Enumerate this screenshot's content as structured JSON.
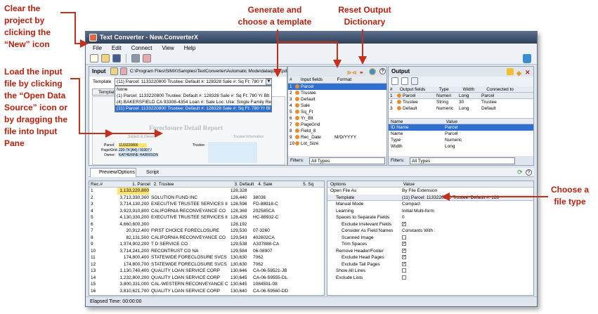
{
  "annotations": {
    "clear_project": "Clear the project by clicking the “New” icon",
    "load_input": "Load the input file by clicking the “Open Data Source” icon or by dragging the file into Input Pane",
    "generate_template": "Generate and choose a template",
    "reset_output": "Reset Output Dictionary",
    "choose_file_type": "Choose a file type"
  },
  "window": {
    "title": "Text Converter - New.ConverterX"
  },
  "menu": [
    "File",
    "Edit",
    "Connect",
    "View",
    "Help"
  ],
  "input": {
    "title": "Input",
    "path": "C:\\Program Files\\SIMX\\Samples\\TextConverter\\Automatic Mode\\dataquick.pdf",
    "template_label": "Template",
    "template_value": "(11) Parcel:  1133220800  Trustee:  Default #:  128328  Sale #:  Sq Ft: 780  Y",
    "dropdown": [
      "None",
      "(1) Parcel:  1133220800  Trustee:  Default #:  128328  Sale #:  Sq Ft: 780  Yr Blt",
      "(4) BAKERSFIELD CA  93308-4354  Loan #:  Sale Loc:  Use: Single Family Residen",
      "(11) Parcel:  1133220800  Trustee:  Default #:  128328  Sale #:  Sq Ft: 780  Yr Bl"
    ],
    "template_tab": "Templat",
    "doc_title": "Foreclosure Detail Report",
    "doc_sub1": "Subject & Owner",
    "doc_sub2": "Trustee Information",
    "doc_lines": [
      "Parcel:",
      "Page/Grid:",
      "Owner:"
    ],
    "doc_values": [
      "1133220800",
      "220-74 [A4] / 93307 /",
      "KATHERINE HARRISON"
    ],
    "doc_trustee": "Trustee:"
  },
  "input_fields": {
    "headers": [
      "#",
      "Input fields",
      "Format"
    ],
    "rows": [
      [
        "1",
        "Parcel",
        ""
      ],
      [
        "2",
        "Trustee",
        ""
      ],
      [
        "3",
        "Default",
        ""
      ],
      [
        "4",
        "Sale",
        ""
      ],
      [
        "5",
        "Sq_Ft",
        ""
      ],
      [
        "6",
        "Yr_Blt",
        ""
      ],
      [
        "7",
        "PageGrid",
        ""
      ],
      [
        "8",
        "Field_8",
        ""
      ],
      [
        "9",
        "Rec_Date",
        "M/D/YYYY"
      ],
      [
        "10",
        "Lot_Size",
        ""
      ]
    ],
    "filter_label": "Filters:",
    "filter_value": "All Types"
  },
  "output": {
    "title": "Output",
    "headers": [
      "#",
      "Output fields",
      "Type",
      "Width",
      "Connected to"
    ],
    "rows": [
      [
        "1",
        "Parcel",
        "Numeri",
        "Long",
        "Parcel"
      ],
      [
        "2",
        "Trustee",
        "String",
        "30",
        "Trustee"
      ],
      [
        "3",
        "Default",
        "Numeric",
        "Long",
        "Default"
      ]
    ],
    "props_headers": [
      "Name",
      "Value"
    ],
    "props": [
      [
        "ID Name",
        "Parcel"
      ],
      [
        "Name",
        "Parcel"
      ],
      [
        "Type",
        "Numeric"
      ],
      [
        "Width",
        "Long"
      ]
    ],
    "filter_label": "Filters:",
    "filter_value": "All Types"
  },
  "tabs": [
    "Preview/Options",
    "Script"
  ],
  "preview": {
    "headers": [
      "Rec.#",
      "1. Parcel",
      "2. Trustee",
      "3. Default",
      "4. Sale",
      "5. Sq"
    ],
    "rows": [
      [
        "1",
        "1,133,220,800",
        "",
        "128,328",
        "",
        ""
      ],
      [
        "2",
        "3,713,330,300",
        "SOLUTION FUND INC",
        "128,440",
        "38036",
        ""
      ],
      [
        "3",
        "3,714,130,200",
        "EXECUTIVE TRUSTEE SERVICES II",
        "128,598",
        "FD-88918-C",
        ""
      ],
      [
        "4",
        "3,923,910,800",
        "CALIFORNIA RECONVEYANCE CO",
        "128,369",
        "202585CA",
        ""
      ],
      [
        "5",
        "4,130,330,200",
        "EXECUTIVE TRUSTEE SERVICES II",
        "128,429",
        "HC-88932-C",
        ""
      ],
      [
        "6",
        "4,660,600,300",
        "",
        "128,192",
        "",
        ""
      ],
      [
        "7",
        "20,912,400",
        "FIRST CHOICE FORECLOSURE",
        "129,530",
        "07-3260",
        ""
      ],
      [
        "8",
        "82,131,500",
        "CALIFORNIA RECONVEYANCE CO",
        "129,543",
        "402602CA",
        ""
      ],
      [
        "9",
        "1,374,902,200",
        "T D SERVICE CO",
        "129,538",
        "A337888-CA",
        ""
      ],
      [
        "10",
        "3,714,241,200",
        "RECONTRUST CO NA",
        "129,584",
        "06-08907",
        ""
      ],
      [
        "11",
        "174,800,400",
        "STATEWIDE FORECLOSURE SVCS",
        "130,630",
        "7062",
        ""
      ],
      [
        "12",
        "174,800,700",
        "STATEWIDE FORECLOSURE SVCS",
        "130,630",
        "7062",
        ""
      ],
      [
        "13",
        "1,130,740,400",
        "QUALITY LOAN SERVICE CORP",
        "130,646",
        "CA-06-59521-JB",
        ""
      ],
      [
        "14",
        "1,232,800,200",
        "QUALITY LOAN SERVICE CORP",
        "130,645",
        "CA-06-59555-DL",
        ""
      ],
      [
        "15",
        "3,800,331,000",
        "CAL-WESTERN RECONVEYANCE C",
        "130,645",
        "1084591-08",
        ""
      ],
      [
        "16",
        "3,810,621,700",
        "QUALITY LOAN SERVICE CORP",
        "130,640",
        "CA-06-59560-DD",
        ""
      ]
    ]
  },
  "options": {
    "headers": [
      "Options",
      "Value"
    ],
    "rows": [
      {
        "name": "Open File As",
        "value": "By File Extension",
        "indent": 0,
        "type": "text"
      },
      {
        "name": "Template",
        "value": "(11) Parcel:  1133220800  Trustee:  Default #:  128",
        "indent": 1,
        "type": "text"
      },
      {
        "name": "Manual Mode",
        "value": "Compact",
        "indent": 1,
        "type": "text"
      },
      {
        "name": "Learning",
        "value": "Initial Multi-form",
        "indent": 1,
        "type": "text"
      },
      {
        "name": "Spaces to Separate Fields",
        "value": "0",
        "indent": 1,
        "type": "text"
      },
      {
        "name": "Exclude Irrelevant Fields",
        "value": "✓",
        "indent": 2,
        "type": "check"
      },
      {
        "name": "Consider As Field Names",
        "value": "Constants With :",
        "indent": 2,
        "type": "text"
      },
      {
        "name": "Scanned Image",
        "value": "",
        "indent": 2,
        "type": "check"
      },
      {
        "name": "Trim Spaces",
        "value": "✓",
        "indent": 2,
        "type": "check"
      },
      {
        "name": "Remove Header/Footer",
        "value": "✓",
        "indent": 1,
        "type": "check"
      },
      {
        "name": "Exclude Head Pages",
        "value": "✓",
        "indent": 2,
        "type": "check"
      },
      {
        "name": "Exclude Tail Pages",
        "value": "✓",
        "indent": 2,
        "type": "check"
      },
      {
        "name": "Show All Lines",
        "value": "",
        "indent": 1,
        "type": "check"
      },
      {
        "name": "Exclude Lists",
        "value": "",
        "indent": 1,
        "type": "check"
      }
    ]
  },
  "status": {
    "elapsed": "Elapsed Time: 00:00:00"
  }
}
